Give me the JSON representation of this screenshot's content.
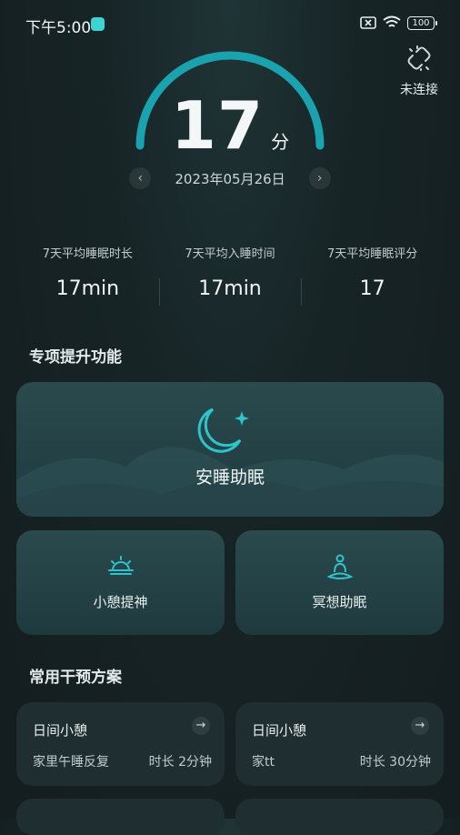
{
  "status_bar": {
    "time": "下午5:00",
    "battery": "100",
    "app_icon": "app-badge-icon"
  },
  "connection": {
    "label": "未连接",
    "icon": "unlink-icon"
  },
  "score": {
    "value": "17",
    "unit": "分",
    "gauge_fraction": 1.0,
    "gauge_color": "#1aa3ae"
  },
  "date": {
    "prev": "‹",
    "text": "2023年05月26日",
    "next": "›"
  },
  "stats": [
    {
      "label": "7天平均睡眠时长",
      "value": "17min"
    },
    {
      "label": "7天平均入睡时间",
      "value": "17min"
    },
    {
      "label": "7天平均睡眠评分",
      "value": "17"
    }
  ],
  "special": {
    "title": "专项提升功能",
    "main": {
      "label": "安睡助眠",
      "icon": "moon-star-icon"
    },
    "items": [
      {
        "label": "小憩提神",
        "icon": "sun-icon"
      },
      {
        "label": "冥想助眠",
        "icon": "meditation-icon"
      }
    ]
  },
  "plans": {
    "title": "常用干预方案",
    "items": [
      {
        "title": "日间小憩",
        "arrow": "→",
        "subtitle": "家里午睡反复",
        "duration": "时长  2分钟"
      },
      {
        "title": "日间小憩",
        "arrow": "→",
        "subtitle": "家tt",
        "duration": "时长  30分钟"
      }
    ]
  },
  "colors": {
    "accent": "#1aa3ae",
    "background": "#172426",
    "card": "#2a4a4e"
  }
}
